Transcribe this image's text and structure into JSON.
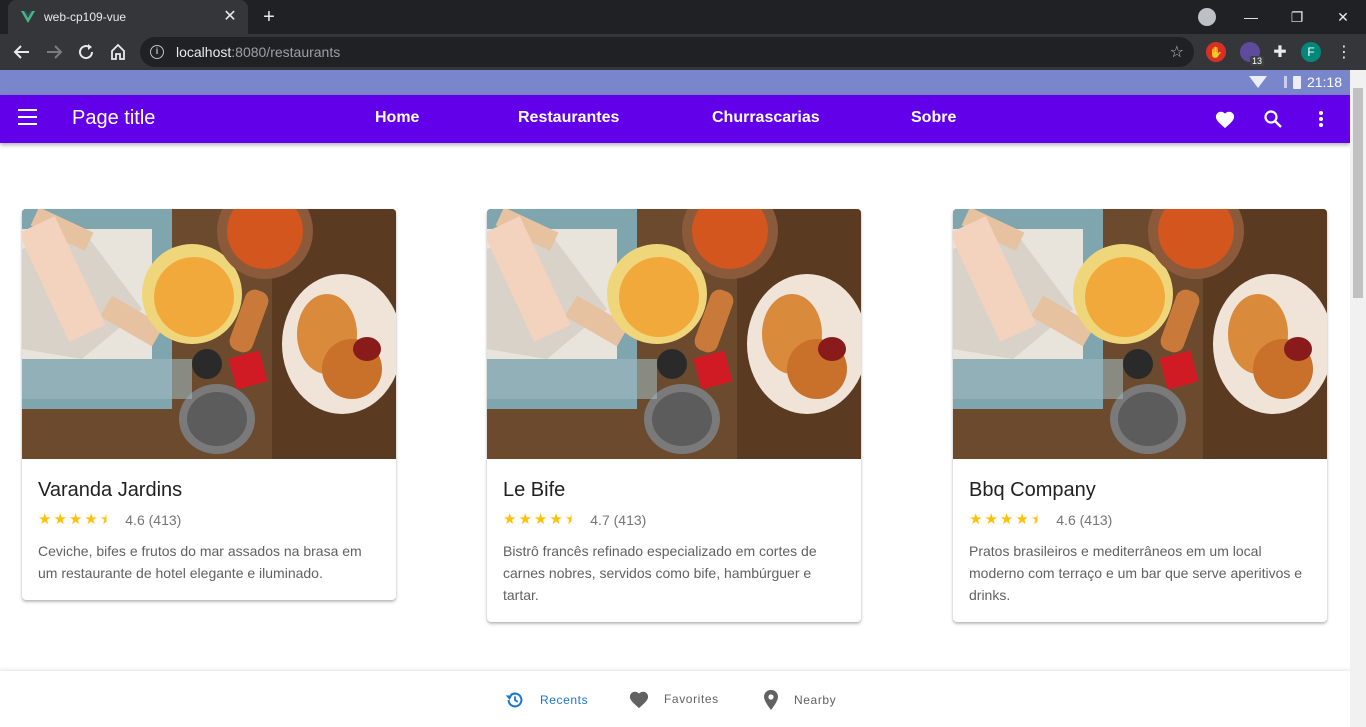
{
  "browser": {
    "tab_title": "web-cp109-vue",
    "url_host": "localhost",
    "url_path": ":8080/restaurants",
    "extension_badge": "13",
    "profile_initial": "F"
  },
  "statusbar": {
    "time": "21:18"
  },
  "appbar": {
    "title": "Page title",
    "nav": [
      "Home",
      "Restaurantes",
      "Churrascarias",
      "Sobre"
    ]
  },
  "restaurants": [
    {
      "name": "Varanda Jardins",
      "rating": "4.6 (413)",
      "description": "Ceviche, bifes e frutos do mar assados na brasa em um restaurante de hotel elegante e iluminado."
    },
    {
      "name": "Le Bife",
      "rating": "4.7 (413)",
      "description": "Bistrô francês refinado especializado em cortes de carnes nobres, servidos como bife, hambúrguer e tartar."
    },
    {
      "name": "Bbq Company",
      "rating": "4.6 (413)",
      "description": "Pratos brasileiros e mediterrâneos em um local moderno com terraço e um bar que serve aperitivos e drinks."
    }
  ],
  "bottom_nav": {
    "recents": "Recents",
    "favorites": "Favorites",
    "nearby": "Nearby"
  },
  "colors": {
    "appbar": "#6200ea",
    "statusbar": "#7986cb",
    "star": "#ffc107",
    "active_nav": "#1976d2"
  },
  "icons": {
    "menu": "hamburger-icon",
    "favorite": "heart-icon",
    "search": "search-icon",
    "more": "more-vert-icon",
    "recents": "history-icon",
    "nearby": "location-pin-icon"
  }
}
